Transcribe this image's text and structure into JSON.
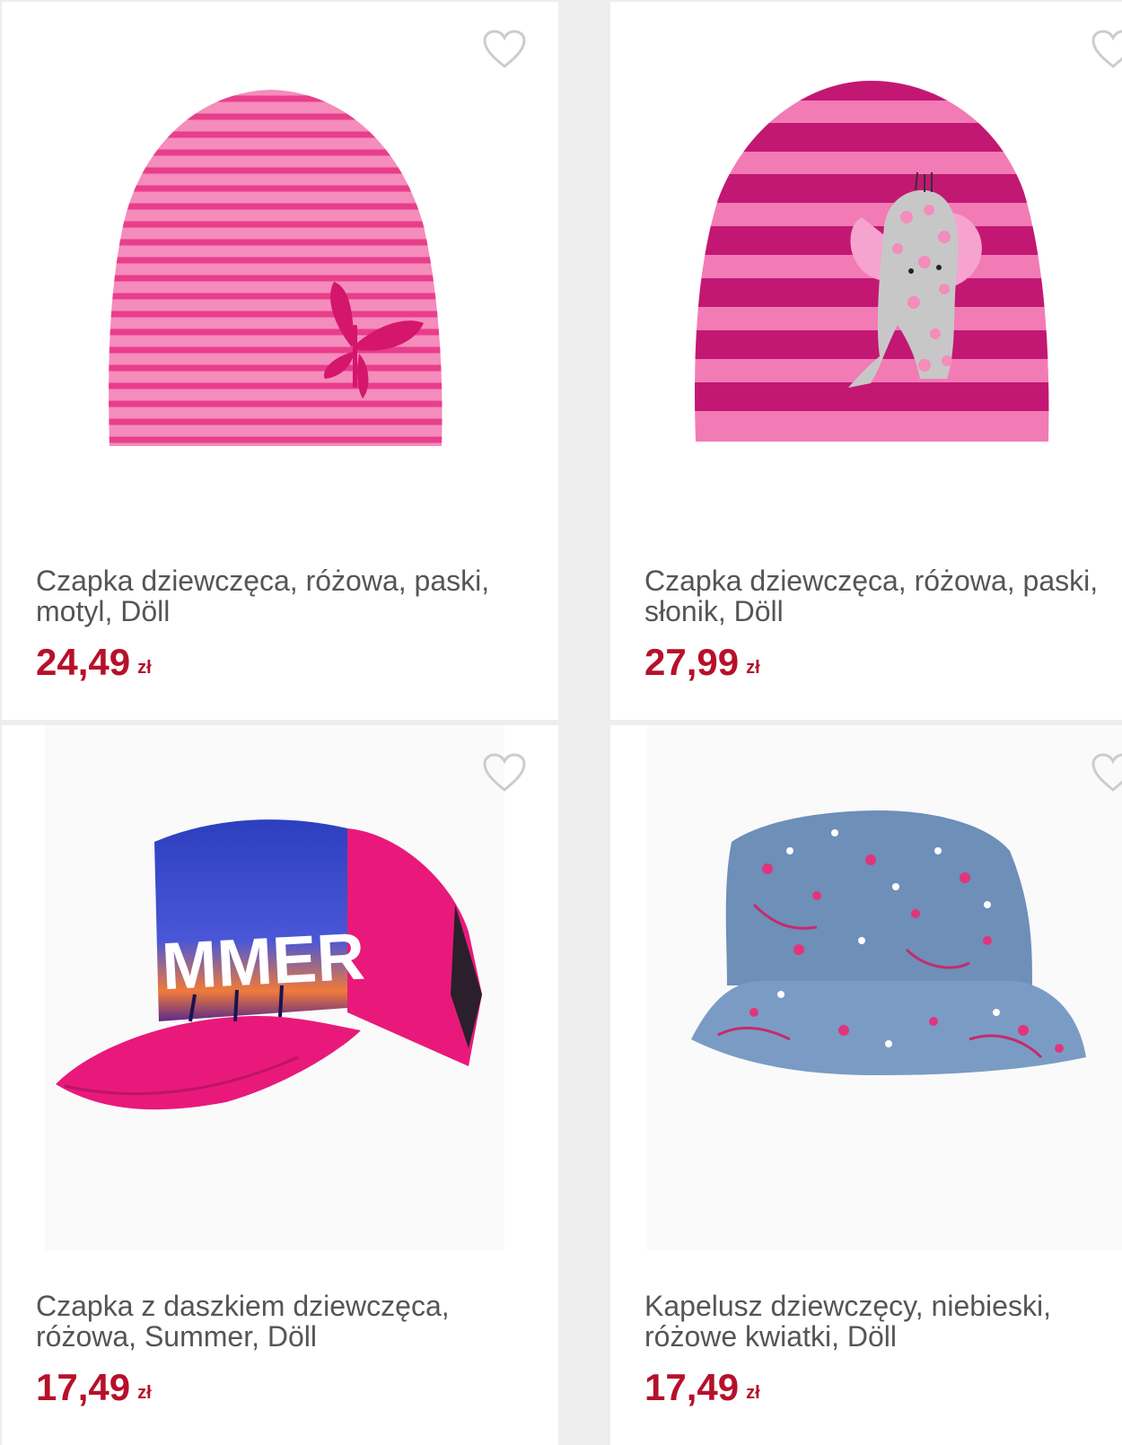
{
  "products": [
    {
      "title": "Czapka dziewczęca, różowa, paski, motyl, Döll",
      "price": "24,49",
      "currency": "zł",
      "image_icon": "pink-striped-beanie-butterfly-image"
    },
    {
      "title": "Czapka dziewczęca, różowa, paski, słonik, Döll",
      "price": "27,99",
      "currency": "zł",
      "image_icon": "pink-striped-beanie-elephant-image"
    },
    {
      "title": "Czapka z daszkiem dziewczęca, różowa, Summer, Döll",
      "price": "17,49",
      "currency": "zł",
      "image_icon": "pink-summer-baseball-cap-image",
      "cap_print": "MMER"
    },
    {
      "title": "Kapelusz dziewczęcy, niebieski, różowe kwiatki, Döll",
      "price": "17,49",
      "currency": "zł",
      "image_icon": "blue-floral-bucket-hat-image"
    }
  ],
  "colors": {
    "price": "#b7102a",
    "title": "#555555",
    "heart_outline": "#cccccc",
    "background": "#eeeeee"
  },
  "icons": {
    "favorite": "heart-outline-icon"
  }
}
